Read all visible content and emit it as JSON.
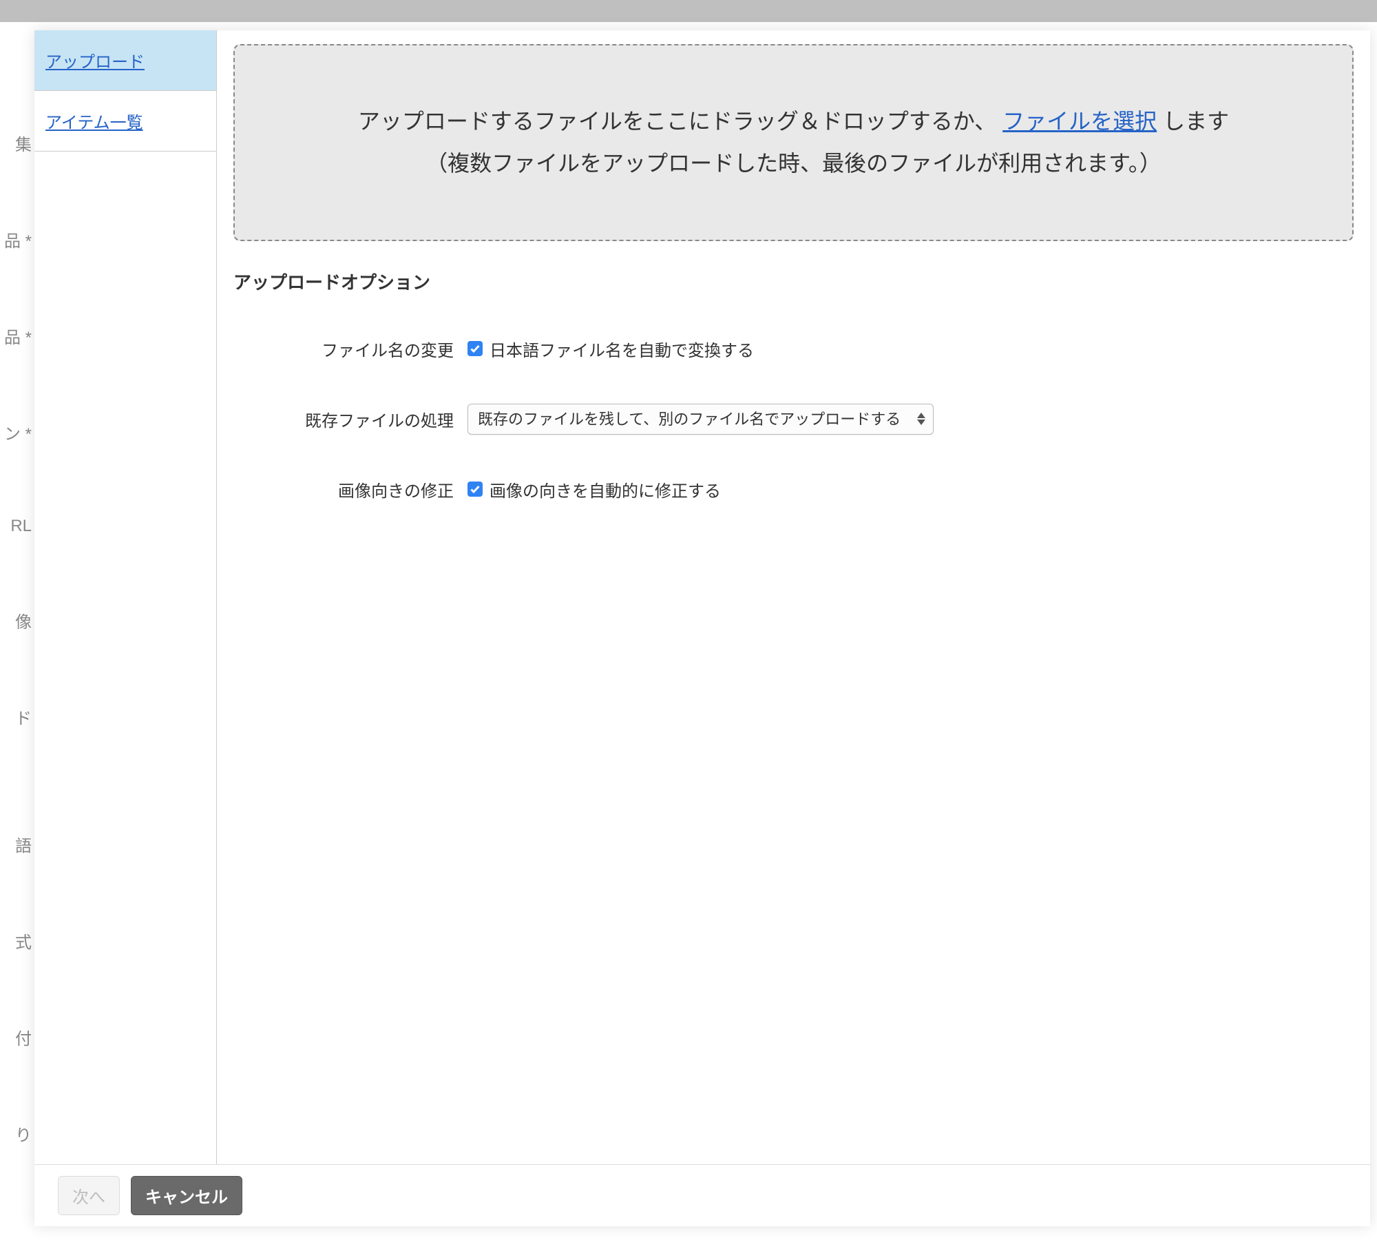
{
  "background": {
    "labels": [
      "集",
      "品 *",
      "品 *",
      "ン *",
      "RL",
      "像",
      "ド",
      "語",
      "式",
      "付",
      "り"
    ]
  },
  "sidebar": {
    "tabs": [
      {
        "label": "アップロード",
        "active": true
      },
      {
        "label": "アイテム一覧",
        "active": false
      }
    ]
  },
  "dropzone": {
    "text_before_link": "アップロードするファイルをここにドラッグ＆ドロップするか、 ",
    "link_text": "ファイルを選択",
    "text_after_link": " します",
    "subtext": "（複数ファイルをアップロードした時、最後のファイルが利用されます。）"
  },
  "options": {
    "heading": "アップロードオプション",
    "filename": {
      "label": "ファイル名の変更",
      "checkbox_label": "日本語ファイル名を自動で変換する",
      "checked": true
    },
    "existing": {
      "label": "既存ファイルの処理",
      "selected": "既存のファイルを残して、別のファイル名でアップロードする"
    },
    "orientation": {
      "label": "画像向きの修正",
      "checkbox_label": "画像の向きを自動的に修正する",
      "checked": true
    }
  },
  "footer": {
    "next_label": "次へ",
    "cancel_label": "キャンセル"
  }
}
